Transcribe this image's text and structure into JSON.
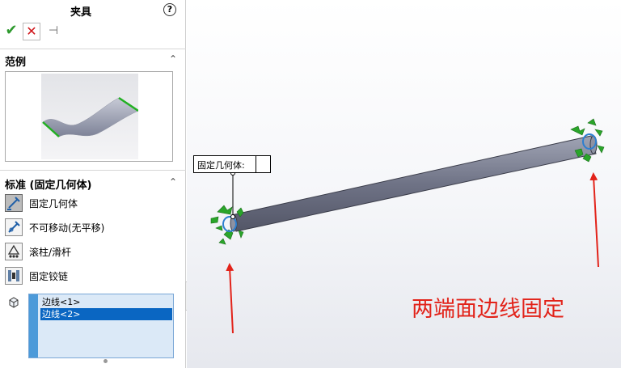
{
  "panel": {
    "title": "夹具",
    "help_icon": "?",
    "actions": {
      "ok_icon": "✔",
      "cancel_icon": "✕",
      "pin_icon": "⊣"
    },
    "example_section": {
      "title": "范例"
    },
    "standard_section": {
      "title": "标准 (固定几何体)",
      "options": [
        {
          "label": "固定几何体",
          "icon": "fixed-geometry-icon",
          "selected": true
        },
        {
          "label": "不可移动(无平移)",
          "icon": "immovable-icon",
          "selected": false
        },
        {
          "label": "滚柱/滑杆",
          "icon": "roller-slider-icon",
          "selected": false
        },
        {
          "label": "固定铰链",
          "icon": "fixed-hinge-icon",
          "selected": false
        }
      ]
    },
    "selection_list": {
      "items": [
        {
          "label": "边线<1>",
          "active": false
        },
        {
          "label": "边线<2>",
          "active": true
        }
      ]
    }
  },
  "viewport": {
    "callout_text": "固定几何体:",
    "annotation_text": "两端面边线固定",
    "annotation_color": "#e2231a",
    "fixture_color": "#2aa52a",
    "beam_color": "#6f7386"
  }
}
